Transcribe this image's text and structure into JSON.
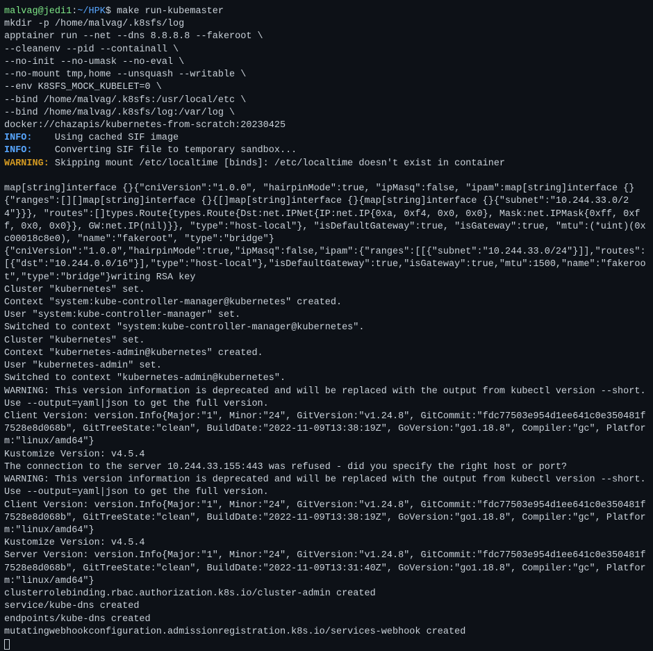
{
  "prompt": {
    "user": "malvag@jedi1",
    "separator": ":",
    "path": "~/HPK",
    "dollar": "$ "
  },
  "command": "make run-kubemaster",
  "lines": {
    "l1": "mkdir -p /home/malvag/.k8sfs/log",
    "l2": "apptainer run --net --dns 8.8.8.8 --fakeroot \\",
    "l3": "--cleanenv --pid --containall \\",
    "l4": "--no-init --no-umask --no-eval \\",
    "l5": "--no-mount tmp,home --unsquash --writable \\",
    "l6": "--env K8SFS_MOCK_KUBELET=0 \\",
    "l7": "--bind /home/malvag/.k8sfs:/usr/local/etc \\",
    "l8": "--bind /home/malvag/.k8sfs/log:/var/log \\",
    "l9": "docker://chazapis/kubernetes-from-scratch:20230425"
  },
  "info": {
    "label1": "INFO:   ",
    "msg1": " Using cached SIF image",
    "label2": "INFO:   ",
    "msg2": " Converting SIF file to temporary sandbox..."
  },
  "warning": {
    "label": "WARNING:",
    "msg": " Skipping mount /etc/localtime [binds]: /etc/localtime doesn't exist in container"
  },
  "blank": "",
  "body": {
    "b1": "map[string]interface {}{\"cniVersion\":\"1.0.0\", \"hairpinMode\":true, \"ipMasq\":false, \"ipam\":map[string]interface {}{\"ranges\":[][]map[string]interface {}{[]map[string]interface {}{map[string]interface {}{\"subnet\":\"10.244.33.0/24\"}}}, \"routes\":[]types.Route{types.Route{Dst:net.IPNet{IP:net.IP{0xa, 0xf4, 0x0, 0x0}, Mask:net.IPMask{0xff, 0xff, 0x0, 0x0}}, GW:net.IP(nil)}}, \"type\":\"host-local\"}, \"isDefaultGateway\":true, \"isGateway\":true, \"mtu\":(*uint)(0xc00018c8e0), \"name\":\"fakeroot\", \"type\":\"bridge\"}",
    "b2": "{\"cniVersion\":\"1.0.0\",\"hairpinMode\":true,\"ipMasq\":false,\"ipam\":{\"ranges\":[[{\"subnet\":\"10.244.33.0/24\"}]],\"routes\":[{\"dst\":\"10.244.0.0/16\"}],\"type\":\"host-local\"},\"isDefaultGateway\":true,\"isGateway\":true,\"mtu\":1500,\"name\":\"fakeroot\",\"type\":\"bridge\"}writing RSA key",
    "b3": "Cluster \"kubernetes\" set.",
    "b4": "Context \"system:kube-controller-manager@kubernetes\" created.",
    "b5": "User \"system:kube-controller-manager\" set.",
    "b6": "Switched to context \"system:kube-controller-manager@kubernetes\".",
    "b7": "Cluster \"kubernetes\" set.",
    "b8": "Context \"kubernetes-admin@kubernetes\" created.",
    "b9": "User \"kubernetes-admin\" set.",
    "b10": "Switched to context \"kubernetes-admin@kubernetes\".",
    "b11": "WARNING: This version information is deprecated and will be replaced with the output from kubectl version --short.  Use --output=yaml|json to get the full version.",
    "b12": "Client Version: version.Info{Major:\"1\", Minor:\"24\", GitVersion:\"v1.24.8\", GitCommit:\"fdc77503e954d1ee641c0e350481f7528e8d068b\", GitTreeState:\"clean\", BuildDate:\"2022-11-09T13:38:19Z\", GoVersion:\"go1.18.8\", Compiler:\"gc\", Platform:\"linux/amd64\"}",
    "b13": "Kustomize Version: v4.5.4",
    "b14": "The connection to the server 10.244.33.155:443 was refused - did you specify the right host or port?",
    "b15": "WARNING: This version information is deprecated and will be replaced with the output from kubectl version --short.  Use --output=yaml|json to get the full version.",
    "b16": "Client Version: version.Info{Major:\"1\", Minor:\"24\", GitVersion:\"v1.24.8\", GitCommit:\"fdc77503e954d1ee641c0e350481f7528e8d068b\", GitTreeState:\"clean\", BuildDate:\"2022-11-09T13:38:19Z\", GoVersion:\"go1.18.8\", Compiler:\"gc\", Platform:\"linux/amd64\"}",
    "b17": "Kustomize Version: v4.5.4",
    "b18": "Server Version: version.Info{Major:\"1\", Minor:\"24\", GitVersion:\"v1.24.8\", GitCommit:\"fdc77503e954d1ee641c0e350481f7528e8d068b\", GitTreeState:\"clean\", BuildDate:\"2022-11-09T13:31:40Z\", GoVersion:\"go1.18.8\", Compiler:\"gc\", Platform:\"linux/amd64\"}",
    "b19": "clusterrolebinding.rbac.authorization.k8s.io/cluster-admin created",
    "b20": "service/kube-dns created",
    "b21": "endpoints/kube-dns created",
    "b22": "mutatingwebhookconfiguration.admissionregistration.k8s.io/services-webhook created"
  }
}
